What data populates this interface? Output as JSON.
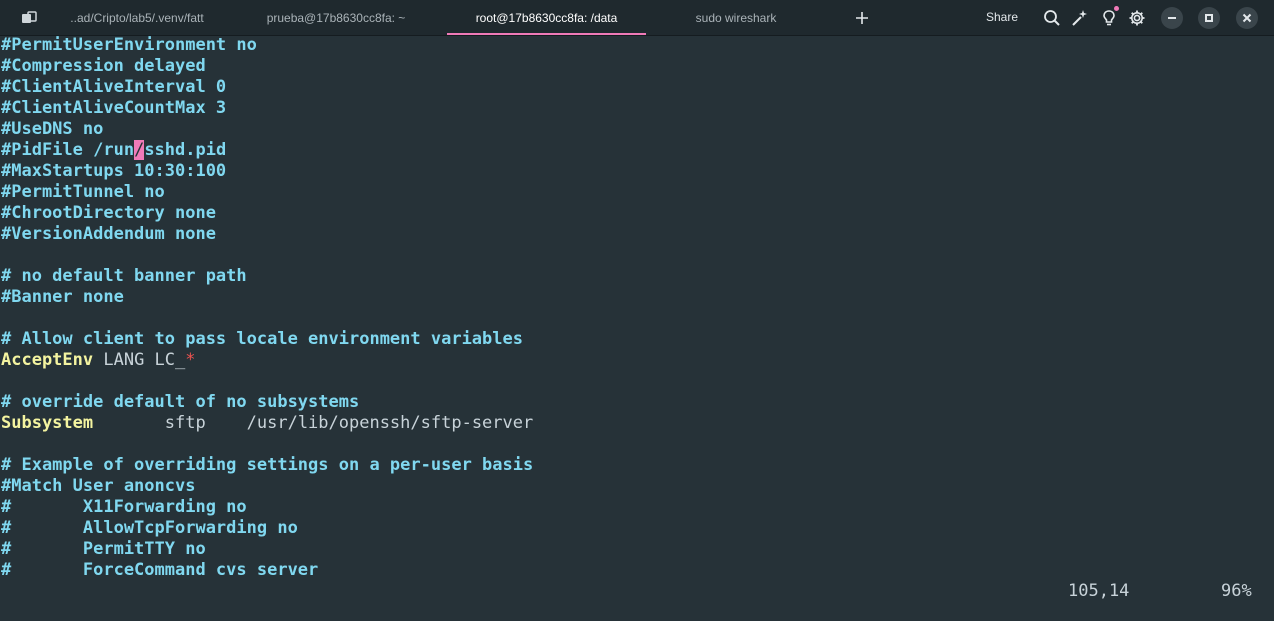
{
  "tabs": [
    {
      "label": "..ad/Cripto/lab5/.venv/fatt",
      "active": false
    },
    {
      "label": "prueba@17b8630cc8fa: ~",
      "active": false
    },
    {
      "label": "root@17b8630cc8fa: /data",
      "active": true
    },
    {
      "label": "sudo wireshark",
      "active": false
    }
  ],
  "toolbar": {
    "share_label": "Share",
    "icons": [
      "overview-icon",
      "plus-icon",
      "search-icon",
      "magic-wand-icon",
      "bulb-icon",
      "gear-icon",
      "minimize-icon",
      "maximize-icon",
      "close-icon"
    ]
  },
  "colors": {
    "background": "#263238",
    "comment": "#80d8f0",
    "keyword": "#f4f4a0",
    "cursor": "#f07ab8",
    "accent": "#f07ab8",
    "star": "#ef5350"
  },
  "editor": {
    "lines": [
      {
        "segments": [
          {
            "text": "#PermitUserEnvironment no",
            "cls": "cmt"
          }
        ]
      },
      {
        "segments": [
          {
            "text": "#Compression delayed",
            "cls": "cmt"
          }
        ]
      },
      {
        "segments": [
          {
            "text": "#ClientAliveInterval 0",
            "cls": "cmt"
          }
        ]
      },
      {
        "segments": [
          {
            "text": "#ClientAliveCountMax 3",
            "cls": "cmt"
          }
        ]
      },
      {
        "segments": [
          {
            "text": "#UseDNS no",
            "cls": "cmt"
          }
        ]
      },
      {
        "segments": [
          {
            "text": "#PidFile /run",
            "cls": "cmt"
          },
          {
            "text": "/",
            "cls": "cursor"
          },
          {
            "text": "sshd.pid",
            "cls": "cmt"
          }
        ]
      },
      {
        "segments": [
          {
            "text": "#MaxStartups 10:30:100",
            "cls": "cmt"
          }
        ]
      },
      {
        "segments": [
          {
            "text": "#PermitTunnel no",
            "cls": "cmt"
          }
        ]
      },
      {
        "segments": [
          {
            "text": "#ChrootDirectory none",
            "cls": "cmt"
          }
        ]
      },
      {
        "segments": [
          {
            "text": "#VersionAddendum none",
            "cls": "cmt"
          }
        ]
      },
      {
        "segments": []
      },
      {
        "segments": [
          {
            "text": "# no default banner path",
            "cls": "cmt"
          }
        ]
      },
      {
        "segments": [
          {
            "text": "#Banner none",
            "cls": "cmt"
          }
        ]
      },
      {
        "segments": []
      },
      {
        "segments": [
          {
            "text": "# Allow client to pass locale environment variables",
            "cls": "cmt"
          }
        ]
      },
      {
        "segments": [
          {
            "text": "AcceptEnv",
            "cls": "kw"
          },
          {
            "text": " LANG LC_",
            "cls": "val"
          },
          {
            "text": "*",
            "cls": "star"
          }
        ]
      },
      {
        "segments": []
      },
      {
        "segments": [
          {
            "text": "# override default of no subsystems",
            "cls": "cmt"
          }
        ]
      },
      {
        "segments": [
          {
            "text": "Subsystem",
            "cls": "kw"
          },
          {
            "text": "       sftp    /usr/lib/openssh/sftp-server",
            "cls": "val"
          }
        ]
      },
      {
        "segments": []
      },
      {
        "segments": [
          {
            "text": "# Example of overriding settings on a per-user basis",
            "cls": "cmt"
          }
        ]
      },
      {
        "segments": [
          {
            "text": "#Match User anoncvs",
            "cls": "cmt"
          }
        ]
      },
      {
        "segments": [
          {
            "text": "#       X11Forwarding no",
            "cls": "cmt"
          }
        ]
      },
      {
        "segments": [
          {
            "text": "#       AllowTcpForwarding no",
            "cls": "cmt"
          }
        ]
      },
      {
        "segments": [
          {
            "text": "#       PermitTTY no",
            "cls": "cmt"
          }
        ]
      },
      {
        "segments": [
          {
            "text": "#       ForceCommand cvs server",
            "cls": "cmt"
          }
        ]
      }
    ]
  },
  "status": {
    "position": "105,14",
    "percent": "96%"
  }
}
